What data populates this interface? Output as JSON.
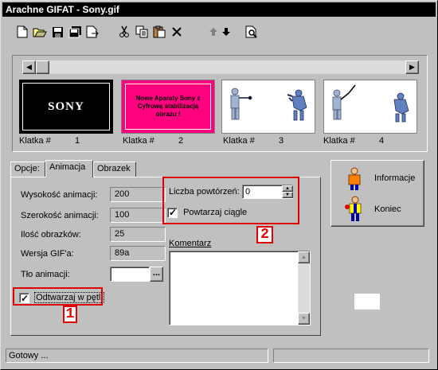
{
  "window": {
    "title": "Arachne GIFAT - Sony.gif"
  },
  "toolbar": {
    "buttons": [
      {
        "name": "new-icon"
      },
      {
        "name": "open-icon"
      },
      {
        "name": "save-icon"
      },
      {
        "name": "save-all-icon"
      },
      {
        "name": "export-icon"
      },
      {
        "name": "cut-icon"
      },
      {
        "name": "copy-icon"
      },
      {
        "name": "paste-icon"
      },
      {
        "name": "delete-icon"
      },
      {
        "name": "move-up-icon"
      },
      {
        "name": "move-down-icon"
      },
      {
        "name": "preview-icon"
      }
    ]
  },
  "frames": [
    {
      "label": "Klatka #",
      "number": "1",
      "text": "SONY",
      "bg": "#000000",
      "fg": "#ffffff"
    },
    {
      "label": "Klatka #",
      "number": "2",
      "text": "Nowe Aparaty Sony z Cyfrową stabilizacją obrazu !",
      "bg": "#ff0080",
      "fg": "#000000"
    },
    {
      "label": "Klatka #",
      "number": "3"
    },
    {
      "label": "Klatka #",
      "number": "4"
    }
  ],
  "tabs": {
    "options": "Opcje:",
    "animation": "Animacja",
    "image": "Obrazek"
  },
  "animation": {
    "height_label": "Wysokość animacji:",
    "height_value": "200",
    "width_label": "Szerokość animacji:",
    "width_value": "100",
    "count_label": "Ilość obrazków:",
    "count_value": "25",
    "version_label": "Wersja GIF'a:",
    "version_value": "89a",
    "background_label": "Tło animacji:",
    "background_button": "...",
    "loop_label": "Odtwarzaj w pętli",
    "repeat_label": "Liczba powtórzeń:",
    "repeat_value": "0",
    "continuous_label": "Powtarzaj ciągle",
    "comment_label": "Komentarz"
  },
  "callouts": {
    "one": "1",
    "two": "2"
  },
  "side": {
    "info": "Informacje",
    "exit": "Koniec"
  },
  "status": {
    "text": "Gotowy ..."
  },
  "colors": {
    "window": "#c0c0c0",
    "titlebar": "#000000",
    "callout": "#e00000",
    "frame2": "#ff0080"
  }
}
